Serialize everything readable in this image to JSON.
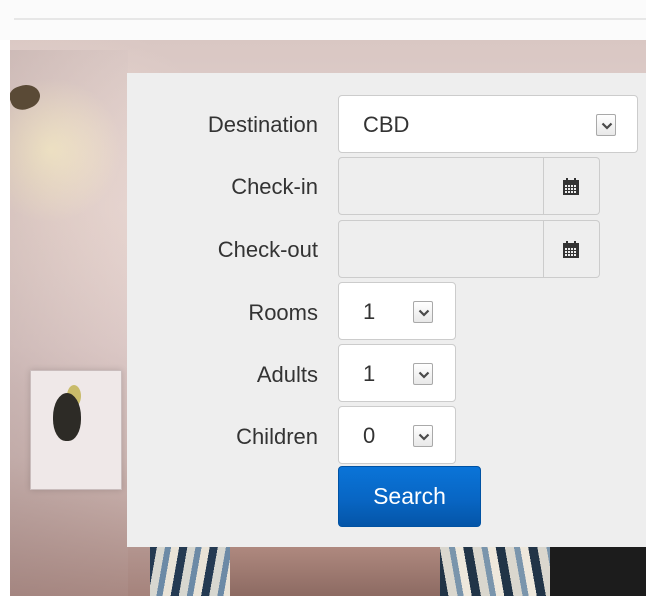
{
  "form": {
    "destination": {
      "label": "Destination",
      "value": "CBD",
      "icon": "chevron-down-icon"
    },
    "checkin": {
      "label": "Check-in",
      "value": "",
      "icon": "calendar-icon"
    },
    "checkout": {
      "label": "Check-out",
      "value": "",
      "icon": "calendar-icon"
    },
    "rooms": {
      "label": "Rooms",
      "value": "1",
      "icon": "chevron-down-icon"
    },
    "adults": {
      "label": "Adults",
      "value": "1",
      "icon": "chevron-down-icon"
    },
    "children": {
      "label": "Children",
      "value": "0",
      "icon": "chevron-down-icon"
    },
    "search_label": "Search"
  },
  "colors": {
    "panel_bg": "#eeeeee",
    "button_primary": "#0866c4",
    "text": "#333333"
  }
}
